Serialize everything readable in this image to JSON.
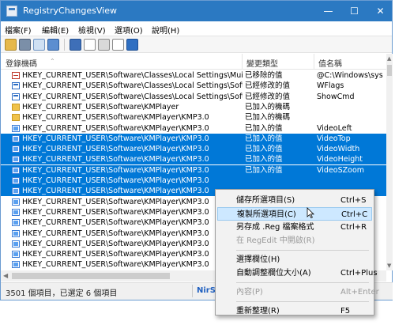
{
  "window": {
    "title": "RegistryChangesView",
    "controls": {
      "minimize": "—",
      "maximize": "☐",
      "close": "✕"
    }
  },
  "menu": [
    "檔案(F)",
    "編輯(E)",
    "檢視(V)",
    "選項(O)",
    "說明(H)"
  ],
  "toolbar": {
    "buttons": [
      "open-icon",
      "save-icon",
      "copy-icon",
      "properties-icon",
      "refresh-icon",
      "export-icon",
      "reg-icon",
      "html-icon",
      "exit-icon"
    ]
  },
  "columns": {
    "key_path": "登錄機碼",
    "change_type": "變更類型",
    "value_name": "值名稱"
  },
  "rows": [
    {
      "icon": "delete",
      "path": "HKEY_CURRENT_USER\\Software\\Classes\\Local Settings\\Mui...",
      "type": "已移除的值",
      "value": "@C:\\Windows\\sys",
      "sel": false
    },
    {
      "icon": "modify",
      "path": "HKEY_CURRENT_USER\\Software\\Classes\\Local Settings\\Soft...",
      "type": "已經修改的值",
      "value": "WFlags",
      "sel": false
    },
    {
      "icon": "modify",
      "path": "HKEY_CURRENT_USER\\Software\\Classes\\Local Settings\\Soft...",
      "type": "已經修改的值",
      "value": "ShowCmd",
      "sel": false
    },
    {
      "icon": "folder",
      "path": "HKEY_CURRENT_USER\\Software\\KMPlayer",
      "type": "已加入的機碼",
      "value": "",
      "sel": false
    },
    {
      "icon": "folder",
      "path": "HKEY_CURRENT_USER\\Software\\KMPlayer\\KMP3.0",
      "type": "已加入的機碼",
      "value": "",
      "sel": false
    },
    {
      "icon": "add",
      "path": "HKEY_CURRENT_USER\\Software\\KMPlayer\\KMP3.0",
      "type": "已加入的值",
      "value": "VideoLeft",
      "sel": false
    },
    {
      "icon": "add",
      "path": "HKEY_CURRENT_USER\\Software\\KMPlayer\\KMP3.0",
      "type": "已加入的值",
      "value": "VideoTop",
      "sel": true
    },
    {
      "icon": "add",
      "path": "HKEY_CURRENT_USER\\Software\\KMPlayer\\KMP3.0",
      "type": "已加入的值",
      "value": "VideoWidth",
      "sel": true
    },
    {
      "icon": "add",
      "path": "HKEY_CURRENT_USER\\Software\\KMPlayer\\KMP3.0",
      "type": "已加入的值",
      "value": "VideoHeight",
      "sel": true
    },
    {
      "icon": "add",
      "path": "HKEY_CURRENT_USER\\Software\\KMPlayer\\KMP3.0",
      "type": "已加入的值",
      "value": "VideoSZoom",
      "sel": true
    },
    {
      "icon": "add",
      "path": "HKEY_CURRENT_USER\\Software\\KMPlayer\\KMP3.0",
      "type": "",
      "value": "",
      "sel": true
    },
    {
      "icon": "add",
      "path": "HKEY_CURRENT_USER\\Software\\KMPlayer\\KMP3.0",
      "type": "",
      "value": "",
      "sel": true
    },
    {
      "icon": "add",
      "path": "HKEY_CURRENT_USER\\Software\\KMPlayer\\KMP3.0",
      "type": "",
      "value": "",
      "sel": false
    },
    {
      "icon": "add",
      "path": "HKEY_CURRENT_USER\\Software\\KMPlayer\\KMP3.0",
      "type": "",
      "value": "",
      "sel": false
    },
    {
      "icon": "add",
      "path": "HKEY_CURRENT_USER\\Software\\KMPlayer\\KMP3.0",
      "type": "",
      "value": "",
      "sel": false
    },
    {
      "icon": "add",
      "path": "HKEY_CURRENT_USER\\Software\\KMPlayer\\KMP3.0",
      "type": "",
      "value": "",
      "sel": false
    },
    {
      "icon": "add",
      "path": "HKEY_CURRENT_USER\\Software\\KMPlayer\\KMP3.0",
      "type": "",
      "value": "",
      "sel": false
    },
    {
      "icon": "add",
      "path": "HKEY_CURRENT_USER\\Software\\KMPlayer\\KMP3.0",
      "type": "",
      "value": "",
      "sel": false
    },
    {
      "icon": "add",
      "path": "HKEY_CURRENT_USER\\Software\\KMPlayer\\KMP3.0",
      "type": "",
      "value": "",
      "sel": false
    }
  ],
  "status": {
    "text": "3501 個項目，已選定 6 個項目",
    "link": "NirSo"
  },
  "context_menu": [
    {
      "label": "儲存所選項目(S)",
      "key": "Ctrl+S",
      "disabled": false,
      "hover": false
    },
    {
      "label": "複製所選項目(C)",
      "key": "Ctrl+C",
      "disabled": false,
      "hover": true
    },
    {
      "label": "另存成 .Reg 檔案格式",
      "key": "Ctrl+R",
      "disabled": false,
      "hover": false
    },
    {
      "label": "在 RegEdit 中開啟(R)",
      "key": "",
      "disabled": true,
      "hover": false
    },
    {
      "sep": true
    },
    {
      "label": "選擇欄位(H)",
      "key": "",
      "disabled": false,
      "hover": false
    },
    {
      "label": "自動調整欄位大小(A)",
      "key": "Ctrl+Plus",
      "disabled": false,
      "hover": false
    },
    {
      "sep": true
    },
    {
      "label": "內容(P)",
      "key": "Alt+Enter",
      "disabled": true,
      "hover": false
    },
    {
      "sep": true
    },
    {
      "label": "重新整理(R)",
      "key": "F5",
      "disabled": false,
      "hover": false
    }
  ],
  "colors": {
    "titlebar": "#2b79c2",
    "selection": "#0078d7",
    "menu_hover": "#cde8ff"
  }
}
